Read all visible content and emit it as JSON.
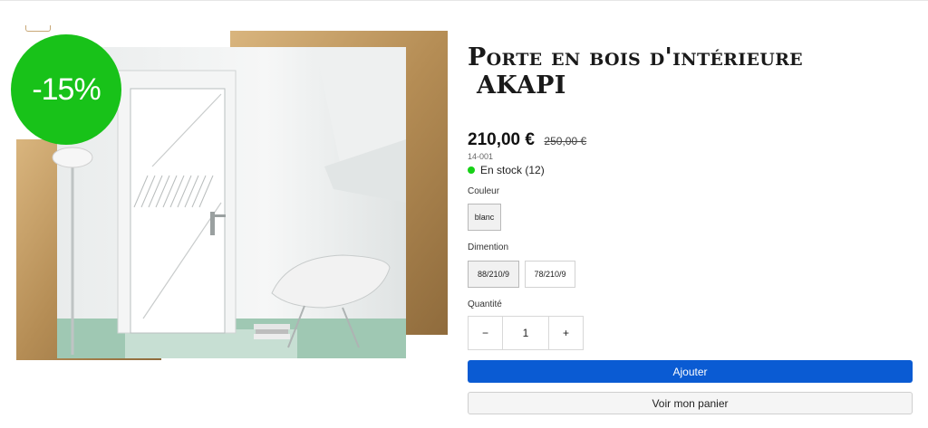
{
  "product": {
    "discount_badge": "-15%",
    "title_line1": "Porte en bois d'intérieure",
    "title_line2": "AKAPI",
    "price": "210,00 €",
    "old_price": "250,00 €",
    "sku": "14-001",
    "stock": "En stock (12)",
    "image_icon": "door-product-photo"
  },
  "options": {
    "color_label": "Couleur",
    "color_values": [
      "blanc"
    ],
    "color_selected": "blanc",
    "dimension_label": "Dimention",
    "dimension_values": [
      "88/210/9",
      "78/210/9"
    ],
    "dimension_selected": "88/210/9"
  },
  "quantity": {
    "label": "Quantité",
    "minus": "−",
    "value": "1",
    "plus": "+"
  },
  "actions": {
    "add_label": "Ajouter",
    "cart_label": "Voir mon panier"
  },
  "colors": {
    "badge": "#18c219",
    "add_button": "#0a5bd3",
    "stock_dot": "#16d116",
    "gold_frame": "#b89158"
  }
}
